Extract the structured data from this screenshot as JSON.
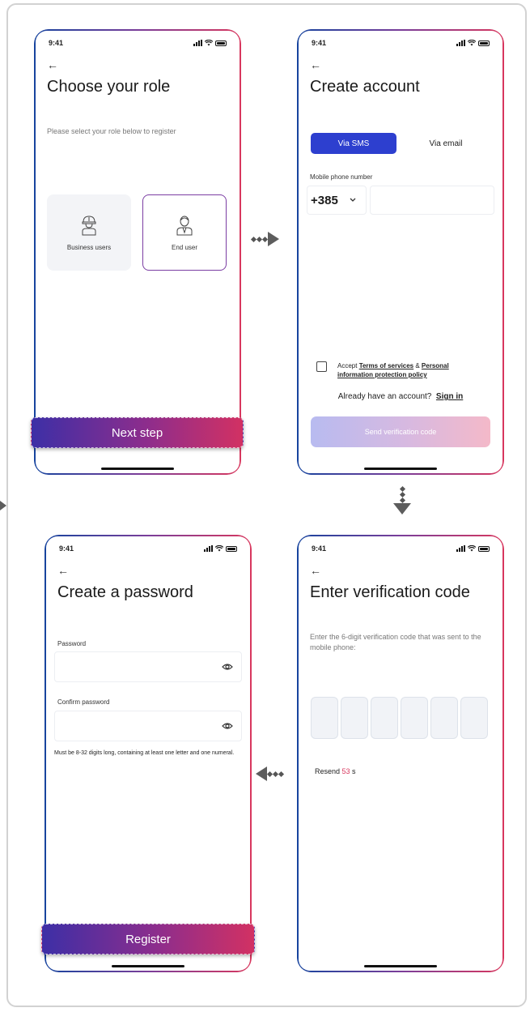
{
  "status_time": "9:41",
  "screen1": {
    "title": "Choose your role",
    "subtitle": "Please select your role below to register",
    "roles": [
      {
        "label": "Business users",
        "icon": "construction-worker-icon"
      },
      {
        "label": "End user",
        "icon": "person-icon",
        "selected": true
      }
    ],
    "next_label": "Next step"
  },
  "screen2": {
    "title": "Create account",
    "tabs": {
      "sms": "Via SMS",
      "email": "Via email",
      "active": "sms"
    },
    "phone_label": "Mobile phone number",
    "country_code": "+385",
    "phone_value": "",
    "accept_prefix": "Accept ",
    "terms_link": "Terms of services",
    "amp": " & ",
    "policy_link_1": "Personal",
    "policy_link_2": "information protection policy",
    "have_account": "Already have an account?",
    "sign_in": "Sign in",
    "send_code": "Send verification code"
  },
  "screen3": {
    "title": "Enter verification code",
    "subtitle": "Enter the 6-digit verification code that was sent to the mobile phone:",
    "resend_prefix": "Resend ",
    "resend_seconds": "53",
    "resend_suffix": " s"
  },
  "screen4": {
    "title": "Create a password",
    "password_label": "Password",
    "confirm_label": "Confirm password",
    "hint": "Must be 8-32 digits long, containing at least one letter and one numeral.",
    "register_label": "Register"
  },
  "colors": {
    "accent_blue": "#2d3fcf",
    "accent_gradient_start": "#3d2fa6",
    "accent_gradient_end": "#d23163",
    "countdown": "#d8375e"
  }
}
